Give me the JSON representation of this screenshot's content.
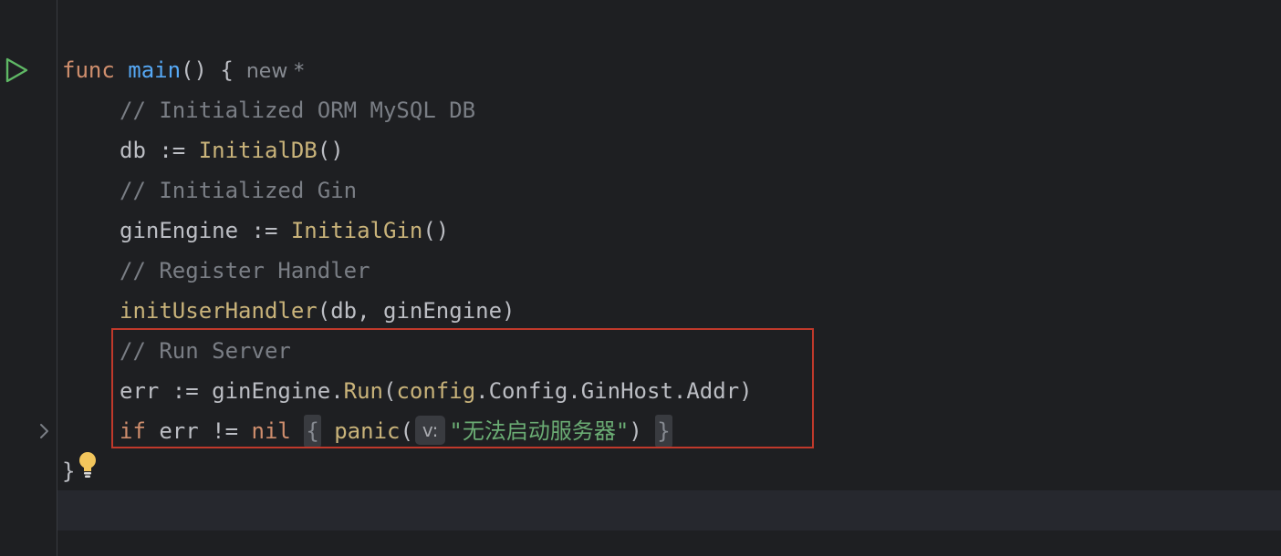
{
  "editor": {
    "top_partial": "}",
    "line1": {
      "kw": "func",
      "name": "main",
      "rest": "() {",
      "hint": "new *"
    },
    "line2": {
      "comment": "// Initialized ORM MySQL DB"
    },
    "line3": {
      "var": "db := ",
      "call": "InitialDB",
      "rest": "()"
    },
    "line4": {
      "comment": "// Initialized Gin"
    },
    "line5": {
      "var": "ginEngine := ",
      "call": "InitialGin",
      "rest": "()"
    },
    "line6": {
      "comment": "// Register Handler"
    },
    "line7": {
      "call": "initUserHandler",
      "rest": "(db, ginEngine)"
    },
    "line8": {
      "comment": "// Run Server"
    },
    "line9": {
      "var": "err := ginEngine.",
      "call": "Run",
      "open": "(",
      "pkg": "config",
      "rest": ".Config.GinHost.Addr)"
    },
    "line10": {
      "kw_if": "if",
      "mid": " err != ",
      "kw_nil": "nil",
      "brace_open": "{",
      "call": "panic",
      "open": "(",
      "param_hint": "v:",
      "str": "\"无法启动服务器\"",
      "close": ")",
      "brace_close": "}"
    },
    "line11": {
      "close": "}"
    }
  },
  "colors": {
    "background": "#1e1f22",
    "keyword": "#cf8e6d",
    "function_decl": "#56a8f5",
    "function_call": "#c9b37a",
    "comment": "#7a7e85",
    "string": "#6aab73",
    "highlight_border": "#c0392b",
    "run_icon": "#5fb865",
    "bulb_icon": "#f2c55c"
  },
  "icons": {
    "run": "run-gutter-icon",
    "fold": "chevron-right-icon",
    "intention": "lightbulb-icon"
  }
}
